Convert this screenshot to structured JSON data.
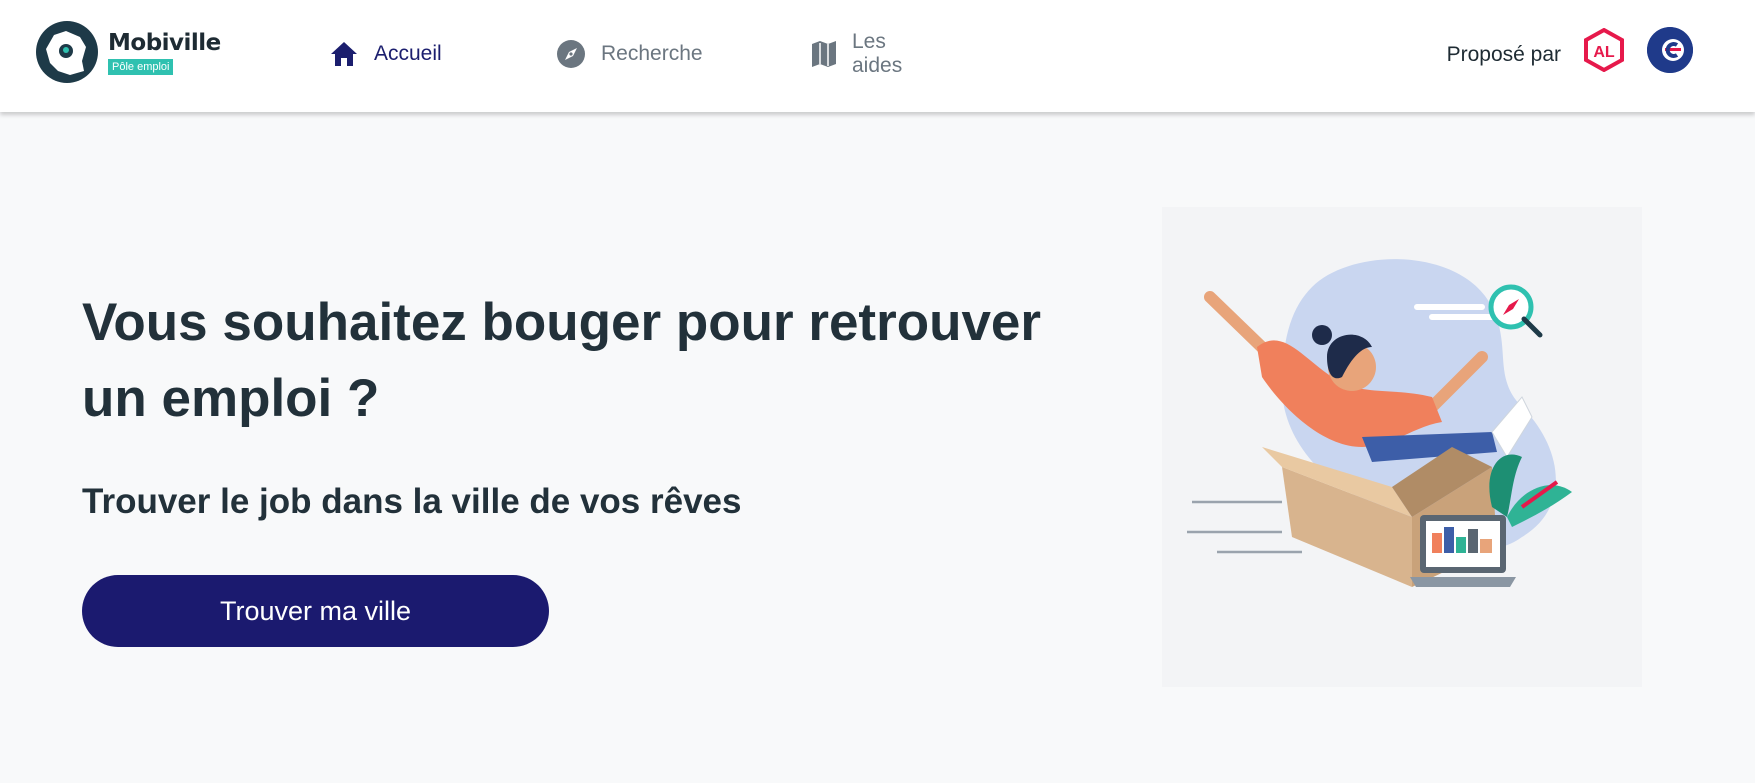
{
  "header": {
    "brand": {
      "name": "Mobiville",
      "tag": "Pôle emploi"
    },
    "nav": [
      {
        "label": "Accueil",
        "icon": "home-icon",
        "active": true
      },
      {
        "label": "Recherche",
        "icon": "compass-icon",
        "active": false
      },
      {
        "label": "Les aides",
        "icon": "map-icon",
        "active": false
      }
    ],
    "partners": {
      "label": "Proposé par",
      "logos": [
        "action-logement-logo",
        "pole-emploi-logo"
      ]
    }
  },
  "hero": {
    "title": "Vous souhaitez bouger pour retrouver un emploi ?",
    "subtitle": "Trouver le job dans la ville de vos rêves",
    "cta_label": "Trouver ma ville",
    "illustration": "person-in-moving-box-illustration"
  },
  "colors": {
    "primary": "#1b1a6f",
    "text": "#22313a",
    "accent": "#2fc1b0",
    "nav_inactive": "#6b7680",
    "partner_red": "#e6194b",
    "partner_blue": "#1f3a8a"
  }
}
